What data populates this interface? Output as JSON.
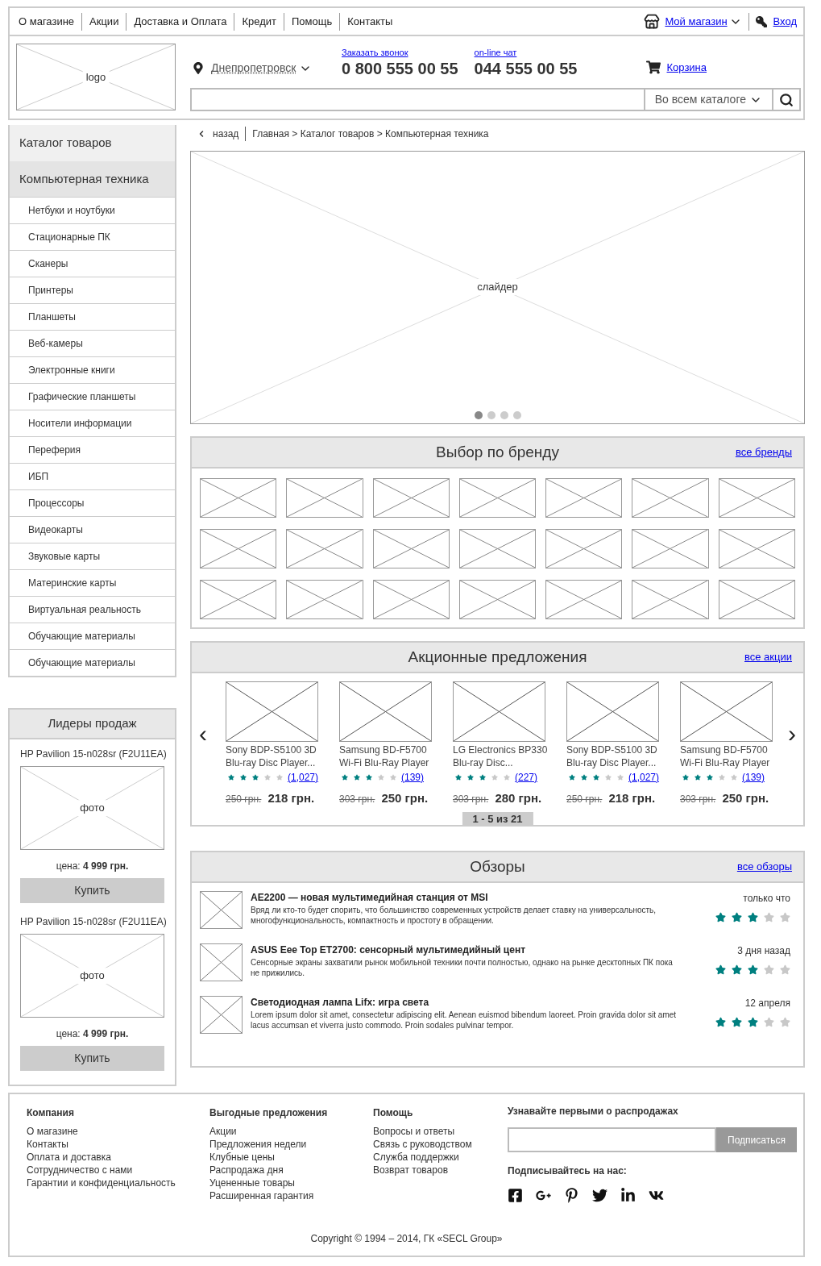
{
  "top_nav": {
    "items": [
      "О магазине",
      "Акции",
      "Доставка и Оплата",
      "Кредит",
      "Помощь",
      "Контакты"
    ],
    "my_store": "Мой магазин",
    "login": "Вход"
  },
  "header": {
    "logo": "logo",
    "city": "Днепропетровск",
    "phones": [
      {
        "link": "Заказать звонок",
        "number": "0 800 555 00 55"
      },
      {
        "link": "on-line чат",
        "number": "044 555 00 55"
      }
    ],
    "cart": "Корзина",
    "search": {
      "scope": "Во всем каталоге"
    }
  },
  "sidebar": {
    "title": "Каталог товаров",
    "category": {
      "label": "Компьютерная техника",
      "selected": true
    },
    "items": [
      "Нетбуки и ноутбуки",
      "Стационарные ПК",
      "Сканеры",
      "Принтеры",
      "Планшеты",
      "Веб-камеры",
      "Электронные книги",
      "Графические планшеты",
      "Носители информации",
      "Переферия",
      "ИБП",
      "Процессоры",
      "Видеокарты",
      "Звуковые карты",
      "Материнские карты",
      "Виртуальная реальность",
      "Обучающие материалы",
      "Обучающие материалы"
    ]
  },
  "leaders": {
    "title": "Лидеры продаж",
    "items": [
      {
        "name": "HP Pavilion 15-n028sr (F2U11EA)",
        "photo": "фото",
        "price_label": "цена:",
        "price": "4 999 грн.",
        "button": "Купить"
      },
      {
        "name": "HP Pavilion 15-n028sr (F2U11EA)",
        "photo": "фото",
        "price_label": "цена:",
        "price": "4 999 грн.",
        "button": "Купить"
      }
    ]
  },
  "breadcrumb": {
    "back": "назад",
    "path": "Главная > Каталог товаров > Компьютерная техника"
  },
  "slider": {
    "label": "слайдер",
    "dots": [
      {
        "selected": true
      },
      {
        "selected": false
      },
      {
        "selected": false
      },
      {
        "selected": false
      }
    ]
  },
  "brands": {
    "title": "Выбор по бренду",
    "link": "все бренды"
  },
  "promo": {
    "title": "Акционные предложения",
    "link": "все акции",
    "prev": "‹",
    "next": "›",
    "pager": "1 - 5 из 21",
    "items": [
      {
        "name": "Sony BDP-S5100 3D Blu-ray Disc Player...",
        "stars": 3,
        "reviews": "(1,027)",
        "old_price": "250 грн.",
        "price": "218 грн."
      },
      {
        "name": "Samsung BD-F5700 Wi-Fi Blu-Ray Player",
        "stars": 3,
        "reviews": "(139)",
        "old_price": "303 грн.",
        "price": "250 грн."
      },
      {
        "name": "LG Electronics BP330 Blu-ray Disc...",
        "stars": 3,
        "reviews": "(227)",
        "old_price": "303 грн.",
        "price": "280 грн."
      },
      {
        "name": "Sony BDP-S5100 3D Blu-ray Disc Player...",
        "stars": 3,
        "reviews": "(1,027)",
        "old_price": "250 грн.",
        "price": "218 грн."
      },
      {
        "name": "Samsung BD-F5700 Wi-Fi Blu-Ray Player",
        "stars": 3,
        "reviews": "(139)",
        "old_price": "303 грн.",
        "price": "250 грн."
      }
    ]
  },
  "reviews": {
    "title": "Обзоры",
    "link": "все обзоры",
    "items": [
      {
        "title": "AE2200 — новая мультимедийная станция от MSI",
        "text": "Вряд ли кто-то будет спорить, что большинство современных устройств делает ставку на универсальность, многофункциональность, компактность и простоту в обращении.",
        "date": "только что",
        "stars": 3
      },
      {
        "title": "ASUS Eee Top ET2700: сенсорный мультимедийный цент",
        "text": "Сенсорные экраны захватили рынок мобильной техники почти полностью, однако на рынке десктопных ПК пока не прижились.",
        "date": "3 дня назад",
        "stars": 3
      },
      {
        "title": "Светодиодная лампа Lifx: игра света",
        "text": "Lorem ipsum dolor sit amet, consectetur adipiscing elit. Aenean euismod bibendum laoreet. Proin gravida dolor sit amet lacus accumsan et viverra justo commodo. Proin sodales pulvinar tempor.",
        "date": "12 апреля",
        "stars": 3
      }
    ]
  },
  "footer": {
    "columns": [
      {
        "title": "Компания",
        "links": [
          "О магазине",
          "Контакты",
          "Оплата и доставка",
          "Сотрудничество с нами",
          "Гарантии и конфиденциальность"
        ]
      },
      {
        "title": "Выгодные предложения",
        "links": [
          "Акции",
          "Предложения недели",
          "Клубные цены",
          "Распродажа дня",
          "Уцененные товары",
          "Расширенная гарантия"
        ]
      },
      {
        "title": "Помощь",
        "links": [
          "Вопросы и ответы",
          "Связь с руководством",
          "Служба поддержки",
          "Возврат товаров"
        ]
      }
    ],
    "subscribe": {
      "title": "Узнавайте первыми о распродажах",
      "button": "Подписаться",
      "social_title": "Подписывайтесь на нас:",
      "social": [
        {
          "kind": "facebook"
        },
        {
          "kind": "googleplus"
        },
        {
          "kind": "pinterest"
        },
        {
          "kind": "twitter"
        },
        {
          "kind": "linkedin"
        },
        {
          "kind": "vk"
        }
      ]
    },
    "copyright": "Copyright © 1994 – 2014, ГК «SECL Group»"
  }
}
